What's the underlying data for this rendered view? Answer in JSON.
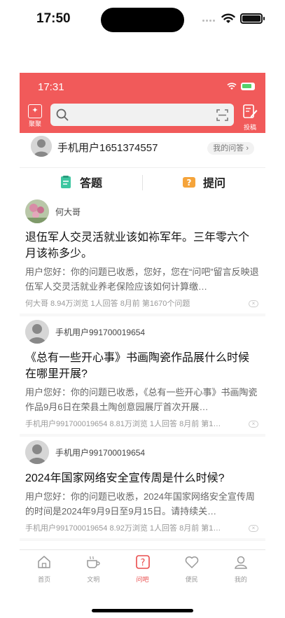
{
  "os": {
    "time": "17:50"
  },
  "inner_status": {
    "time": "17:31"
  },
  "header": {
    "left_label": "聚聚",
    "right_label": "投稿"
  },
  "user": {
    "name": "手机用户1651374557",
    "my_answers": "我的问答 ›"
  },
  "tabs": [
    {
      "label": "答题"
    },
    {
      "label": "提问"
    }
  ],
  "feed": [
    {
      "author": "何大哥",
      "title": "退伍军人交灵活就业该如袮军年。三年零六个月该袮多少。",
      "body": "用户您好：你的问题已收悉，您好，您在“问吧”留言反映退伍军人交灵活就业养老保险应该如何计算缴…",
      "meta": "何大哥 8.94万浏览 1人回答 8月前 第1670个问题"
    },
    {
      "author": "手机用户991700019654",
      "title": "《总有一些开心事》书画陶瓷作品展什么时候在哪里开展?",
      "body": "用户您好：你的问题已收悉，《总有一些开心事》书画陶瓷作品9月6日在荣县土陶创意园展厅首次开展…",
      "meta": "手机用户991700019654 8.81万浏览 1人回答 8月前 第1…"
    },
    {
      "author": "手机用户991700019654",
      "title": "2024年国家网络安全宣传周是什么时候?",
      "body": "用户您好：你的问题已收悉，2024年国家网络安全宣传周的时间是2024年9月9日至9月15日。请持续关…",
      "meta": "手机用户991700019654 8.92万浏览 1人回答 8月前 第1…"
    }
  ],
  "tabbar": [
    {
      "label": "首页",
      "icon": "home-icon"
    },
    {
      "label": "文明",
      "icon": "cup-icon"
    },
    {
      "label": "问吧",
      "icon": "question-icon"
    },
    {
      "label": "便民",
      "icon": "heart-icon"
    },
    {
      "label": "我的",
      "icon": "user-icon"
    }
  ],
  "colors": {
    "brand": "#f15a5a",
    "active_tab": "#e94b4b"
  }
}
